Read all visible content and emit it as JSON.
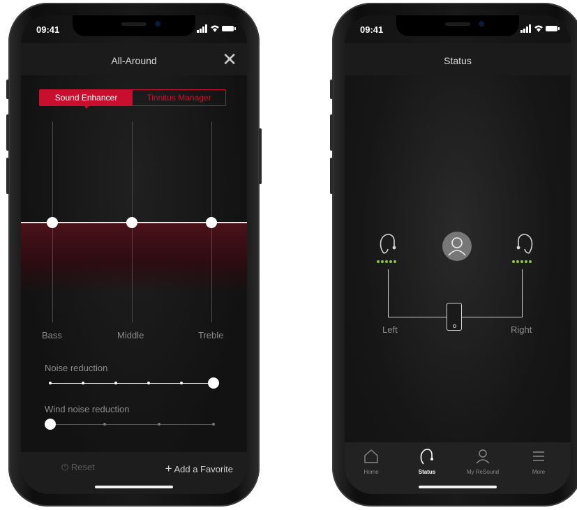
{
  "left_phone": {
    "status": {
      "time": "09:41",
      "icons": "signal wifi battery"
    },
    "header": {
      "title": "All-Around",
      "close_icon": "close-icon"
    },
    "segments": [
      "Sound Enhancer",
      "Tinnitus Manager"
    ],
    "equalizer": {
      "labels": [
        "Bass",
        "Middle",
        "Treble"
      ],
      "levels": [
        0.5,
        0.5,
        0.5
      ]
    },
    "noise_reduction": {
      "label": "Noise reduction",
      "level": 1.0,
      "steps": 6
    },
    "wind_noise_reduction": {
      "label": "Wind noise reduction",
      "level": 0.0,
      "steps": 4
    },
    "bottom": {
      "reset": "Reset",
      "add_favorite": "Add a Favorite"
    },
    "colors": {
      "accent": "#c8102e"
    }
  },
  "right_phone": {
    "status": {
      "time": "09:41"
    },
    "header": {
      "title": "Status"
    },
    "devices": {
      "left": "Left",
      "right": "Right",
      "battery_dots": 5,
      "battery_color": "#8cc63f"
    },
    "tabs": [
      {
        "label": "Home",
        "icon": "home-icon"
      },
      {
        "label": "Status",
        "icon": "hearing-aid-icon"
      },
      {
        "label": "My ReSound",
        "icon": "person-icon"
      },
      {
        "label": "More",
        "icon": "menu-icon"
      }
    ],
    "active_tab": 1
  }
}
